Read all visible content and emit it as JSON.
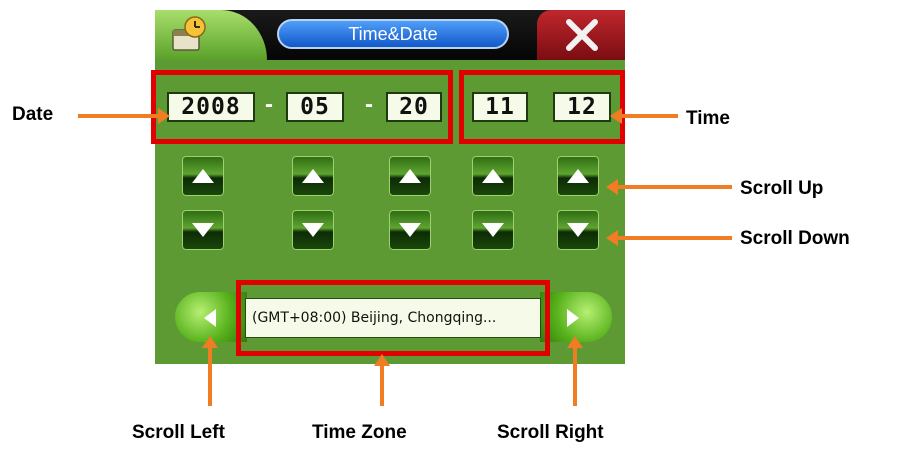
{
  "window": {
    "title": "Time&Date"
  },
  "icons": {
    "app": "calendar-clock-icon",
    "close": "close-x-icon"
  },
  "date": {
    "year": "2008",
    "month": "05",
    "day": "20",
    "separator": "-"
  },
  "time": {
    "hour": "11",
    "minute": "12"
  },
  "timezone": {
    "value": "(GMT+08:00) Beijing, Chongqing..."
  },
  "callouts": {
    "date": "Date",
    "time": "Time",
    "scroll_up": "Scroll Up",
    "scroll_down": "Scroll Down",
    "scroll_left": "Scroll Left",
    "time_zone": "Time Zone",
    "scroll_right": "Scroll Right"
  },
  "colors": {
    "screen_bg": "#5e9a33",
    "annotation_red": "#e00000",
    "annotation_orange": "#f07c24",
    "title_blue": "#1158c9"
  }
}
